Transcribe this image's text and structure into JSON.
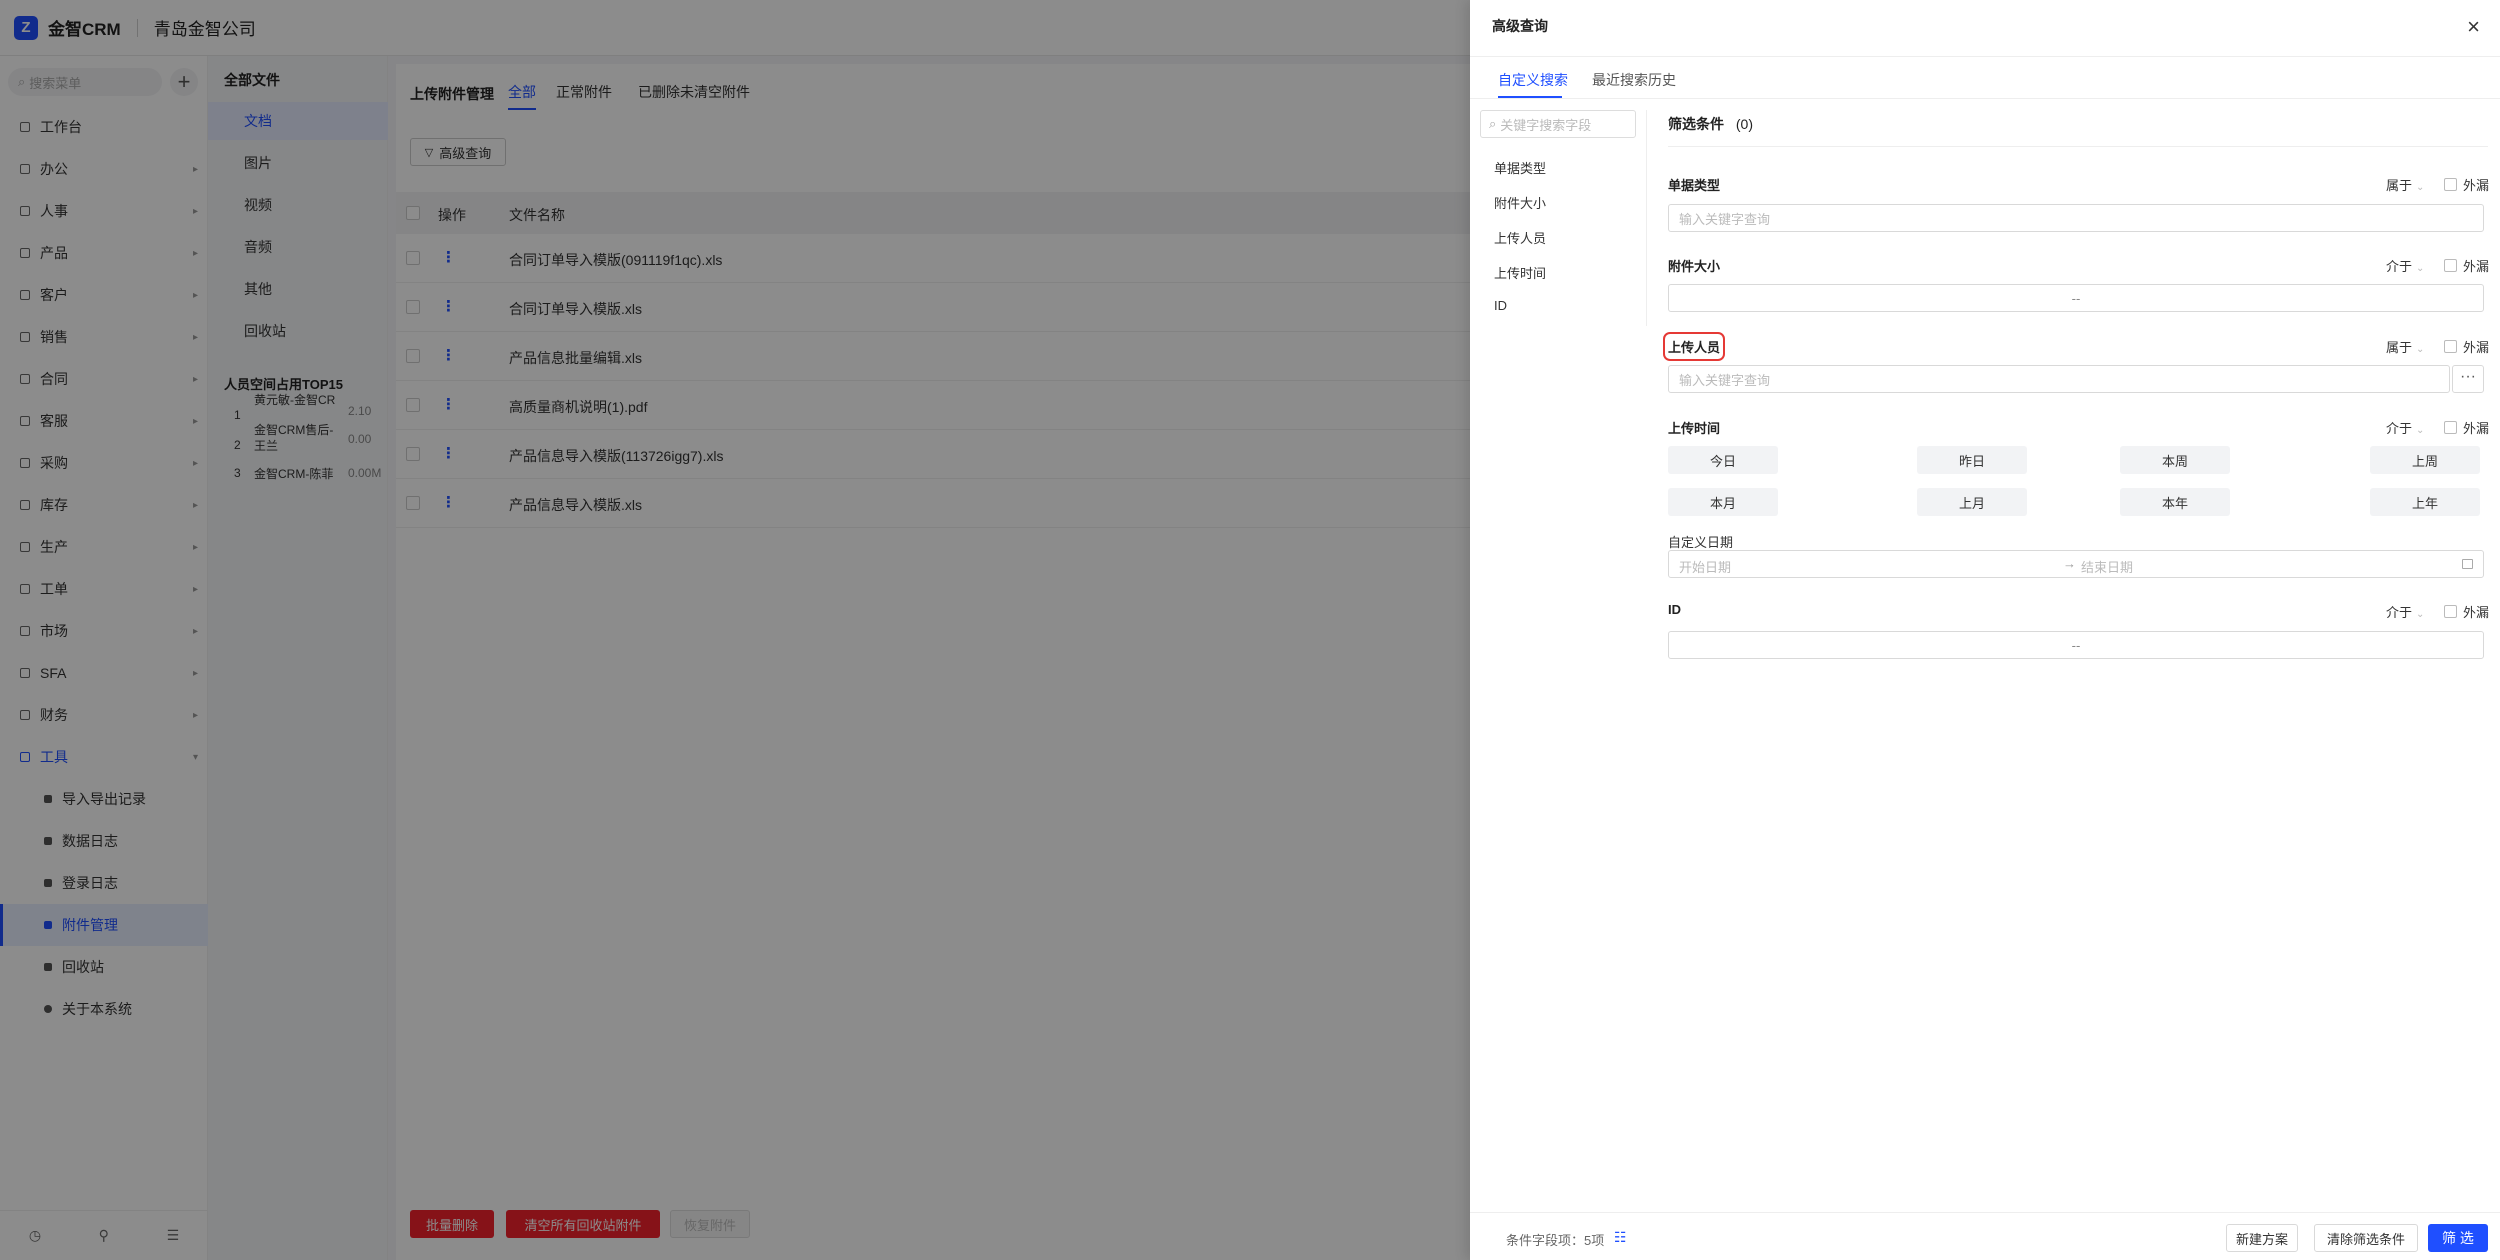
{
  "app": {
    "logo_mark": "Z",
    "logo_text": "金智CRM",
    "company": "青岛金智公司"
  },
  "sidebar": {
    "search_placeholder": "搜索菜单",
    "add_label": "+",
    "items": [
      {
        "label": "工作台",
        "icon": "dashboard-icon"
      },
      {
        "label": "办公",
        "icon": "office-icon",
        "arrow": "▸"
      },
      {
        "label": "人事",
        "icon": "people-icon",
        "arrow": "▸"
      },
      {
        "label": "产品",
        "icon": "product-icon",
        "arrow": "▸"
      },
      {
        "label": "客户",
        "icon": "customer-icon",
        "arrow": "▸"
      },
      {
        "label": "销售",
        "icon": "sales-icon",
        "arrow": "▸"
      },
      {
        "label": "合同",
        "icon": "contract-icon",
        "arrow": "▸"
      },
      {
        "label": "客服",
        "icon": "service-icon",
        "arrow": "▸"
      },
      {
        "label": "采购",
        "icon": "purchase-icon",
        "arrow": "▸"
      },
      {
        "label": "库存",
        "icon": "inventory-icon",
        "arrow": "▸"
      },
      {
        "label": "生产",
        "icon": "production-icon",
        "arrow": "▸"
      },
      {
        "label": "工单",
        "icon": "ticket-icon",
        "arrow": "▸"
      },
      {
        "label": "市场",
        "icon": "market-icon",
        "arrow": "▸"
      },
      {
        "label": "SFA",
        "icon": "sfa-icon",
        "arrow": "▸"
      },
      {
        "label": "财务",
        "icon": "finance-icon",
        "arrow": "▸"
      },
      {
        "label": "工具",
        "icon": "tools-icon",
        "arrow": "▾"
      }
    ],
    "sub_items": [
      {
        "label": "导入导出记录"
      },
      {
        "label": "数据日志"
      },
      {
        "label": "登录日志"
      },
      {
        "label": "附件管理"
      },
      {
        "label": "回收站"
      },
      {
        "label": "关于本系统"
      }
    ],
    "footer": {
      "history": "◷",
      "stats": "⚲",
      "collapse": "☰"
    }
  },
  "file_panel": {
    "title": "全部文件",
    "types": [
      "文档",
      "图片",
      "视频",
      "音频",
      "其他",
      "回收站"
    ],
    "top15_title": "人员空间占用TOP15",
    "top15": [
      {
        "rank": "1",
        "name": "黄元敏-金智CR",
        "size": "2.10"
      },
      {
        "rank": "2",
        "name": "金智CRM售后-王兰",
        "size": "0.00"
      },
      {
        "rank": "3",
        "name": "金智CRM-陈菲",
        "size": "0.00M"
      }
    ]
  },
  "main": {
    "title": "上传附件管理",
    "tabs": [
      "全部",
      "正常附件",
      "已删除未清空附件"
    ],
    "adv_button": "高级查询",
    "columns": [
      "操作",
      "文件名称"
    ],
    "rows": [
      "合同订单导入模版(091119f1qc).xls",
      "合同订单导入模版.xls",
      "产品信息批量编辑.xls",
      "高质量商机说明(1).pdf",
      "产品信息导入模版(113726igg7).xls",
      "产品信息导入模版.xls"
    ],
    "row_action": "⋮",
    "batch_delete": "批量删除",
    "clear_recycle": "清空所有回收站附件",
    "restore": "恢复附件"
  },
  "drawer": {
    "title": "高级查询",
    "close": "×",
    "tabs": [
      "自定义搜索",
      "最近搜索历史"
    ],
    "field_search_placeholder": "关键字搜索字段",
    "fields": [
      "单据类型",
      "附件大小",
      "上传人员",
      "上传时间",
      "ID"
    ],
    "filter_title": "筛选条件",
    "filter_count": "(0)",
    "exclude_label": "外漏",
    "doc_type": {
      "label": "单据类型",
      "op": "属于",
      "placeholder": "输入关键字查询"
    },
    "size": {
      "label": "附件大小",
      "op": "介于",
      "range": "--"
    },
    "uploader": {
      "label": "上传人员",
      "op": "属于",
      "placeholder": "输入关键字查询",
      "more": "···"
    },
    "upload_time": {
      "label": "上传时间",
      "op": "介于",
      "quick": [
        "今日",
        "昨日",
        "本周",
        "上周",
        "本月",
        "上月",
        "本年",
        "上年"
      ],
      "custom_label": "自定义日期",
      "start_placeholder": "开始日期",
      "arrow": "→",
      "end_placeholder": "结束日期"
    },
    "id": {
      "label": "ID",
      "op": "介于",
      "range": "--"
    },
    "footer": {
      "cond_count": "条件字段项：5项",
      "new_plan": "新建方案",
      "clear": "清除筛选条件",
      "filter": "筛 选"
    }
  },
  "colors": {
    "accent": "#1f4fff",
    "danger": "#f5222d",
    "highlight": "#e53935"
  }
}
